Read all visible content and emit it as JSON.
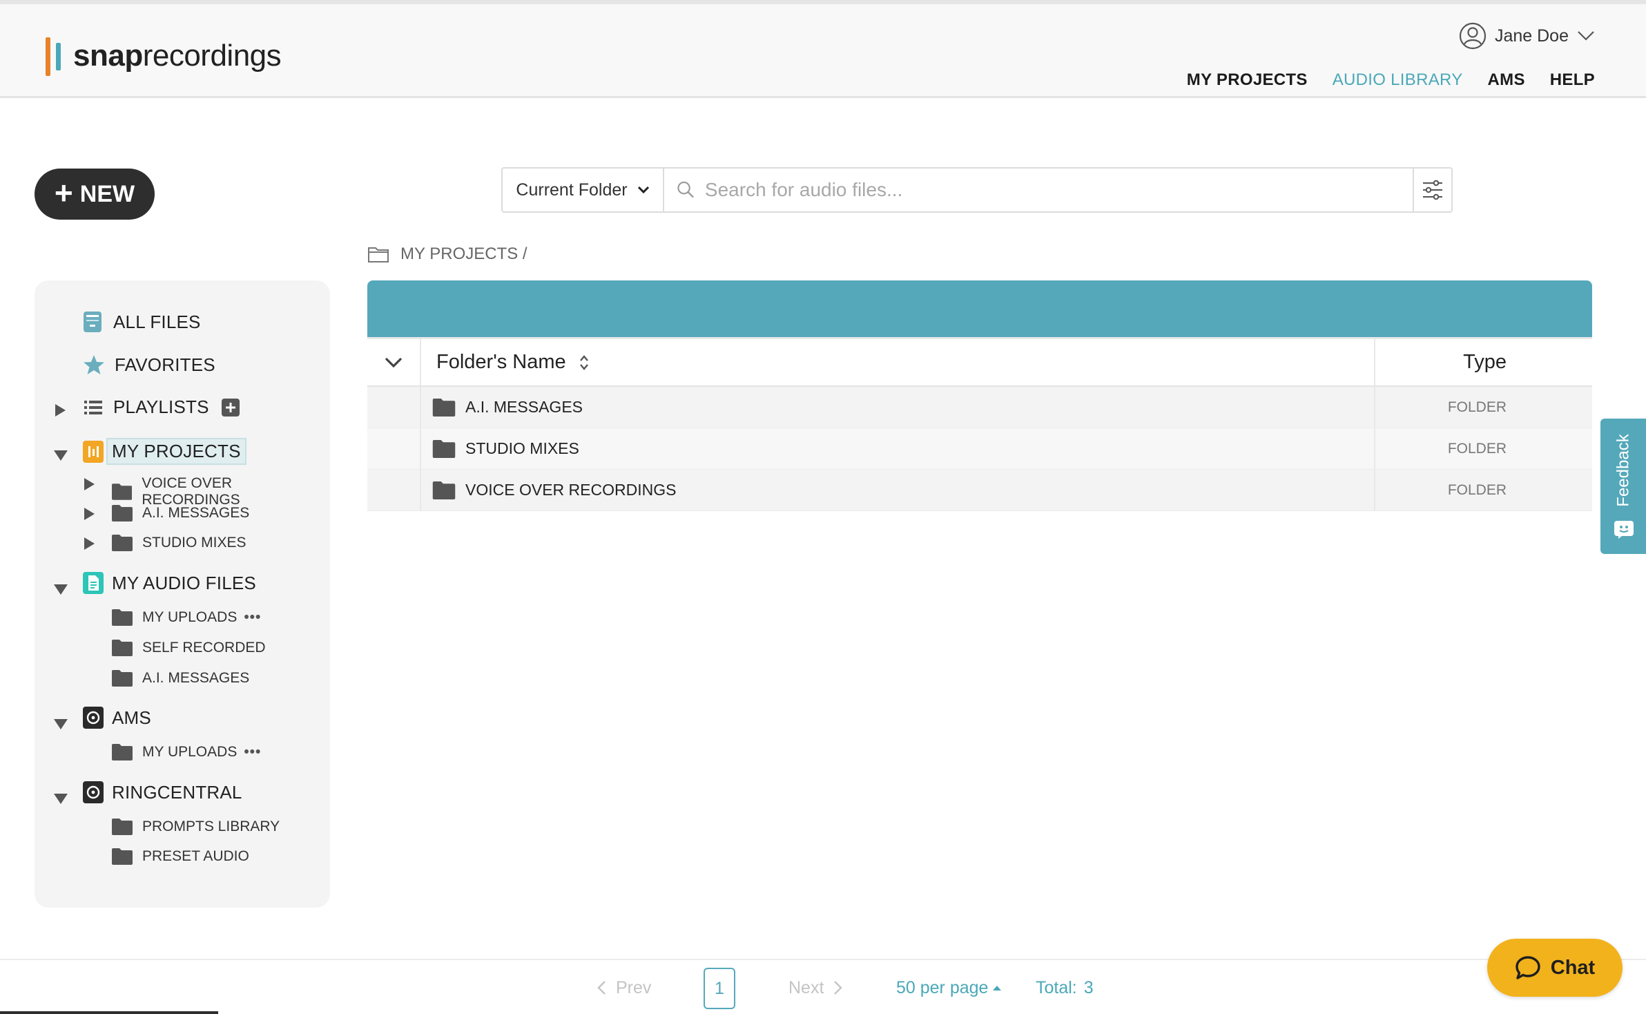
{
  "header": {
    "logo_bold": "snap",
    "logo_regular": "recordings",
    "user_name": "Jane Doe",
    "nav": [
      {
        "label": "MY PROJECTS",
        "active": false
      },
      {
        "label": "AUDIO LIBRARY",
        "active": true
      },
      {
        "label": "AMS",
        "active": false
      },
      {
        "label": "HELP",
        "active": false
      }
    ]
  },
  "new_button": {
    "label": "NEW"
  },
  "search": {
    "scope_label": "Current Folder",
    "placeholder": "Search for audio files..."
  },
  "breadcrumb": {
    "path": "MY PROJECTS /"
  },
  "sidebar": {
    "all_files": "ALL FILES",
    "favorites": "FAVORITES",
    "playlists": "PLAYLISTS",
    "my_projects": {
      "label": "MY PROJECTS",
      "children": [
        "VOICE OVER RECORDINGS",
        "A.I. MESSAGES",
        "STUDIO MIXES"
      ]
    },
    "my_audio_files": {
      "label": "MY AUDIO FILES",
      "children": [
        "MY UPLOADS",
        "SELF RECORDED",
        "A.I. MESSAGES"
      ],
      "more": "•••"
    },
    "ams": {
      "label": "AMS",
      "children": [
        "MY UPLOADS"
      ],
      "more": "•••"
    },
    "ringcentral": {
      "label": "RINGCENTRAL",
      "children": [
        "PROMPTS LIBRARY",
        "PRESET AUDIO"
      ]
    }
  },
  "table": {
    "columns": {
      "name": "Folder's Name",
      "type": "Type"
    },
    "rows": [
      {
        "name": "A.I. MESSAGES",
        "type": "FOLDER"
      },
      {
        "name": "STUDIO MIXES",
        "type": "FOLDER"
      },
      {
        "name": "VOICE OVER RECORDINGS",
        "type": "FOLDER"
      }
    ]
  },
  "feedback": {
    "label": "Feedback"
  },
  "pagination": {
    "prev": "Prev",
    "current_page": "1",
    "next": "Next",
    "per_page": "50 per page",
    "total_label": "Total:",
    "total_value": "3"
  },
  "chat": {
    "label": "Chat"
  },
  "colors": {
    "accent": "#55a8ba",
    "logo_orange": "#e8832a",
    "projects_icon": "#f2a623",
    "audio_files_icon": "#2cc5b7",
    "chat_bg": "#f2b21c"
  }
}
